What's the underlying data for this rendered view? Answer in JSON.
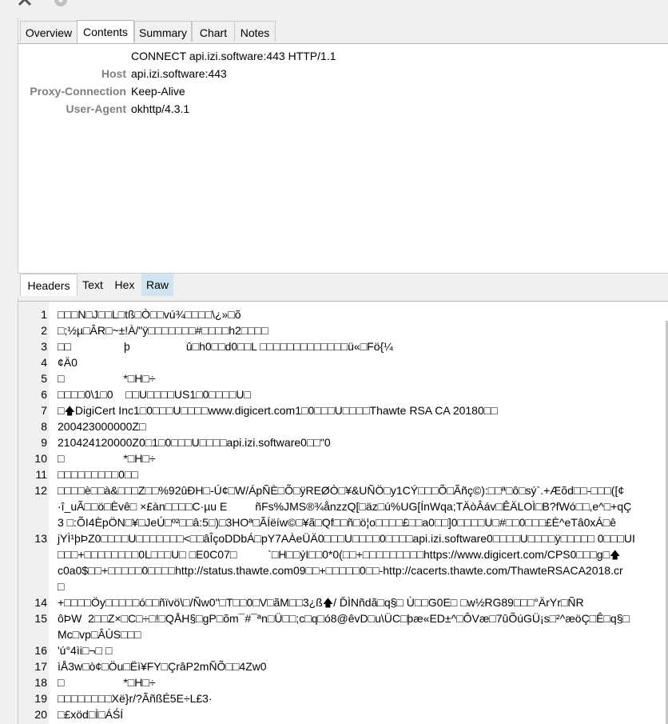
{
  "toolbar": {
    "icons": [
      "wrench-icon",
      "gear-icon"
    ]
  },
  "top_tabs": [
    "Overview",
    "Contents",
    "Summary",
    "Chart",
    "Notes"
  ],
  "active_top_tab": "Contents",
  "request": {
    "line": "CONNECT api.izi.software:443 HTTP/1.1",
    "headers": [
      {
        "name": "Host",
        "value": "api.izi.software:443"
      },
      {
        "name": "Proxy-Connection",
        "value": "Keep-Alive"
      },
      {
        "name": "User-Agent",
        "value": "okhttp/4.3.1"
      }
    ]
  },
  "bottom_tabs": [
    "Headers",
    "Text",
    "Hex",
    "Raw"
  ],
  "active_bottom_tab": "Headers",
  "raw_lines": [
    {
      "n": "1",
      "segs": [
        "□□□N□J□□L□tß□Ò□□vú¾□□□□\\¿»□õ"
      ]
    },
    {
      "n": "2",
      "segs": [
        "□;½µ□ÂR□~±!À/\"ÿ□□□□□□□#□□□□h2□□□□"
      ]
    },
    {
      "n": "3",
      "segs": [
        "□□                 þ                  û□h0□□d0□□L □□□□□□□□□□□□□ü«□Fö{¼"
      ]
    },
    {
      "n": "4",
      "segs": [
        "¢Ä0"
      ]
    },
    {
      "n": "5",
      "segs": [
        "□                   *□H□÷"
      ]
    },
    {
      "n": "6",
      "segs": [
        "□□□□0\\1□0    □□U□□□□US1□0□□□□U□"
      ]
    },
    {
      "n": "7",
      "segs": [
        "□",
        "DigiCert Inc1□0□□□U□□□□www.digicert.com1□0□□□U□□□□Thawte RSA CA 20180□□"
      ]
    },
    {
      "n": "8",
      "segs": [
        "200423000000Z□"
      ]
    },
    {
      "n": "9",
      "segs": [
        "210424120000Z0□1□0□□□U□□□□api.izi.software0□□\"0"
      ]
    },
    {
      "n": "10",
      "segs": [
        "□                   *□H□÷"
      ]
    },
    {
      "n": "11",
      "segs": [
        "□□□□□□□□□0□□"
      ]
    },
    {
      "n": "12",
      "segs": [
        "□□□□è□□à&□□□Z□□%92ûÐH□-Ú¢□W/ÁpÑÈ□Õ□ÿREØÒ□¥&UÑÖ□y1CÝ□□□Õ□Ãñç©):□□ª□ô□sý`.+Æõd□□-□□□([¢"
      ]
    },
    {
      "n": "",
      "segs": [
        "·î_uÃ□□ö□Èvê□ ×£àn□□□□C·µu E         ñFs%JMS®¾ånzzQ[□äz□ú%UG[ÍnWqa;TÄòÂáv□ÊÄLOÌ□B?fWó□□,e^□+qÇ"
      ]
    },
    {
      "n": "",
      "segs": [
        "3 □:ÕI4ÈpÖN□¥□JeÚ□º²□□â:5□)□3HOª□ÃÍëíw©□¥ã□Qf□□ñ□ö¦o□□□□£□□a0□□]0□□□□U□#□□0□□□£È^eTâ0xÁ□ê"
      ]
    },
    {
      "n": "13",
      "segs": [
        "jYÌ¹þÞZ0□□□□U□□□□□□□<□□âÎçoDDbÁ□pY7AÀeÜÄ0□□□U□□□□0□□□□api.izi.software0□□□□U□□□□ÿ□□□□□ 0□□□UI"
      ]
    },
    {
      "n": "",
      "segs": [
        "□□□+□□□□□□□□0L□□□U□ □E0C07□          `□H□□ýI□□0*0(□□+□□□□□□□□□https://www.digicert.com/CPS0□□□g□",
        ""
      ]
    },
    {
      "n": "",
      "segs": [
        "c0a0$□□+□□□□□0□□□□http://status.thawte.com09□□+□□□□□0□□-http://cacerts.thawte.com/ThawteRSACA2018.cr"
      ]
    },
    {
      "n": "",
      "segs": [
        "□"
      ]
    },
    {
      "n": "14",
      "segs": [
        "+□□□□Öy□□□□□ó□□ñïvö\\□/Ñw0\"□T□□0□V□ãM□□3¿ß",
        "/ ĎÌNñdã□q§□ Ù□□G0E□ □w½RG89□□□°ÄrYr□ÑR"
      ]
    },
    {
      "n": "15",
      "segs": [
        "ôÞW  2□□Z×□C□÷□!□QÅH§□gP□õm¯#¯ªn□Ü□□;c□q□ó8@êvD□u\\ÜC□þæ«ED±^□ÔVæ□7ûÕúGÜ¡s□²^æöÇ□Ê□q§□"
      ]
    },
    {
      "n": "",
      "segs": [
        "Mc□vp□ÂÙS□□□"
      ]
    },
    {
      "n": "16",
      "segs": [
        "'ú°4ìi□¬□ □"
      ]
    },
    {
      "n": "17",
      "segs": [
        "ìÅ3w□ò¢□Öu□Ëì¥FY□ÇrâP2mÑÕ□□4Zw0"
      ]
    },
    {
      "n": "18",
      "segs": [
        "□                   *□H□÷"
      ]
    },
    {
      "n": "19",
      "segs": [
        "□□□□□□□□Xë}r/?ÃñßÉ5E÷L£3·"
      ]
    },
    {
      "n": "20",
      "segs": [
        "□£xöd□Ì□ÁŚÍ"
      ]
    }
  ]
}
